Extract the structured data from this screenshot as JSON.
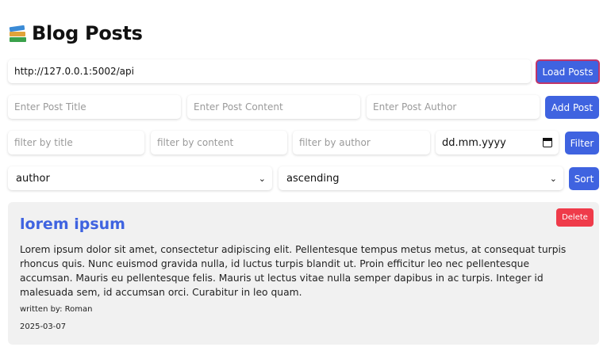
{
  "header": {
    "title": "Blog Posts",
    "icon": "books-icon"
  },
  "api": {
    "url_value": "http://127.0.0.1:5002/api",
    "load_label": "Load Posts"
  },
  "add_post": {
    "title_placeholder": "Enter Post Title",
    "content_placeholder": "Enter Post Content",
    "author_placeholder": "Enter Post Author",
    "add_label": "Add Post"
  },
  "filter": {
    "title_placeholder": "filter by title",
    "content_placeholder": "filter by content",
    "author_placeholder": "filter by author",
    "date_placeholder": "dd.mm.yyyy",
    "filter_label": "Filter"
  },
  "sort": {
    "field_value": "author",
    "order_value": "ascending",
    "sort_label": "Sort"
  },
  "posts": [
    {
      "title": "lorem ipsum",
      "content": "Lorem ipsum dolor sit amet, consectetur adipiscing elit. Pellentesque tempus metus metus, at consequat turpis rhoncus quis. Nunc euismod gravida nulla, id luctus turpis blandit ut. Proin efficitur leo nec pellentesque accumsan. Mauris eu pellentesque felis. Mauris ut lectus vitae nulla semper dapibus in ac turpis. Integer id malesuada sem, id accumsan orci. Curabitur in leo quam.",
      "author": "written by: Roman",
      "date": "2025-03-07",
      "delete_label": "Delete"
    }
  ],
  "colors": {
    "primary": "#3f63e0",
    "danger": "#ef3b4a",
    "card_bg": "#f1f1f1"
  }
}
